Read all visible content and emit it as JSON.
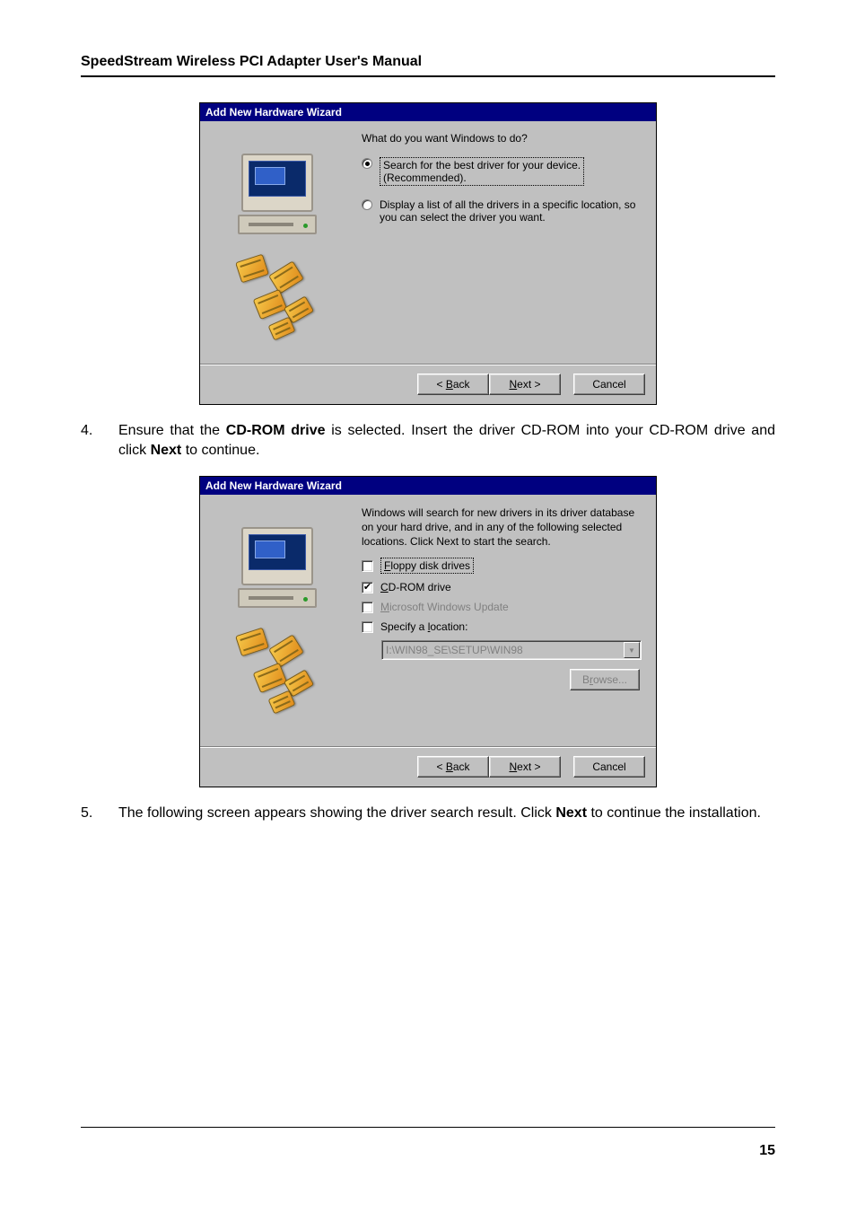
{
  "header": {
    "title": "SpeedStream Wireless PCI Adapter User's Manual"
  },
  "page_number": "15",
  "steps": {
    "s4": {
      "num": "4.",
      "pre": "Ensure that the ",
      "bold1": "CD-ROM drive",
      "mid": " is selected. Insert the driver CD-ROM into your CD-ROM drive and click ",
      "bold2": "Next",
      "post": " to continue."
    },
    "s5": {
      "num": "5.",
      "pre": "The following screen appears showing the driver search result. Click ",
      "bold1": "Next",
      "post": " to continue the installation."
    }
  },
  "dialog1": {
    "title": "Add New Hardware Wizard",
    "prompt": "What do you want Windows to do?",
    "opt1_line1": "Search for the best driver for your device.",
    "opt1_line2": "(Recommended).",
    "opt2": "Display a list of all the drivers in a specific location, so you can select the driver you want.",
    "back": "< Back",
    "back_u": "B",
    "next": "Next >",
    "next_u": "N",
    "cancel": "Cancel"
  },
  "dialog2": {
    "title": "Add New Hardware Wizard",
    "intro": "Windows will search for new drivers in its driver database on your hard drive, and in any of the following selected locations. Click Next to start the search.",
    "floppy": "Floppy disk drives",
    "floppy_u": "F",
    "cdrom": "CD-ROM drive",
    "cdrom_u": "C",
    "mwu": "Microsoft Windows Update",
    "mwu_u": "M",
    "specify": "Specify a location:",
    "specify_u": "l",
    "location_value": "I:\\WIN98_SE\\SETUP\\WIN98",
    "browse": "Browse...",
    "browse_u": "r",
    "back": "< Back",
    "back_u": "B",
    "next": "Next >",
    "next_u": "N",
    "cancel": "Cancel"
  }
}
